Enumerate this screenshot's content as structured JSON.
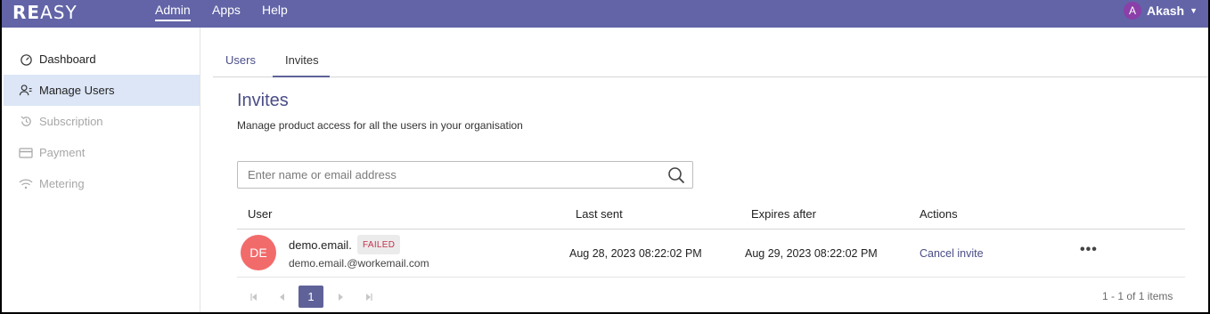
{
  "app": {
    "logo_main": "RE",
    "logo_rest": "ASY"
  },
  "topnav": {
    "admin": "Admin",
    "apps": "Apps",
    "help": "Help"
  },
  "user": {
    "initial": "A",
    "name": "Akash"
  },
  "sidebar": {
    "items": [
      {
        "label": "Dashboard",
        "icon": "gauge-icon",
        "state": "normal"
      },
      {
        "label": "Manage Users",
        "icon": "users-icon",
        "state": "active"
      },
      {
        "label": "Subscription",
        "icon": "history-icon",
        "state": "disabled"
      },
      {
        "label": "Payment",
        "icon": "card-icon",
        "state": "disabled"
      },
      {
        "label": "Metering",
        "icon": "wifi-icon",
        "state": "disabled"
      }
    ]
  },
  "tabs": {
    "users": "Users",
    "invites": "Invites"
  },
  "page": {
    "title": "Invites",
    "subtitle": "Manage product access for all the users in your organisation"
  },
  "search": {
    "placeholder": "Enter name or email address",
    "value": ""
  },
  "table": {
    "headers": {
      "user": "User",
      "last_sent": "Last sent",
      "expires_after": "Expires after",
      "actions": "Actions"
    },
    "rows": [
      {
        "initials": "DE",
        "name": "demo.email.",
        "status": "FAILED",
        "email": "demo.email.@workemail.com",
        "last_sent": "Aug 28, 2023 08:22:02 PM",
        "expires_after": "Aug 29, 2023 08:22:02 PM",
        "action": "Cancel invite",
        "more": "•••"
      }
    ]
  },
  "pagination": {
    "current": "1",
    "info": "1 - 1 of 1 items"
  },
  "colors": {
    "brand": "#6264a7",
    "active_side": "#dce6f7",
    "failed": "#c4314b",
    "avatar": "#f26b6b"
  }
}
